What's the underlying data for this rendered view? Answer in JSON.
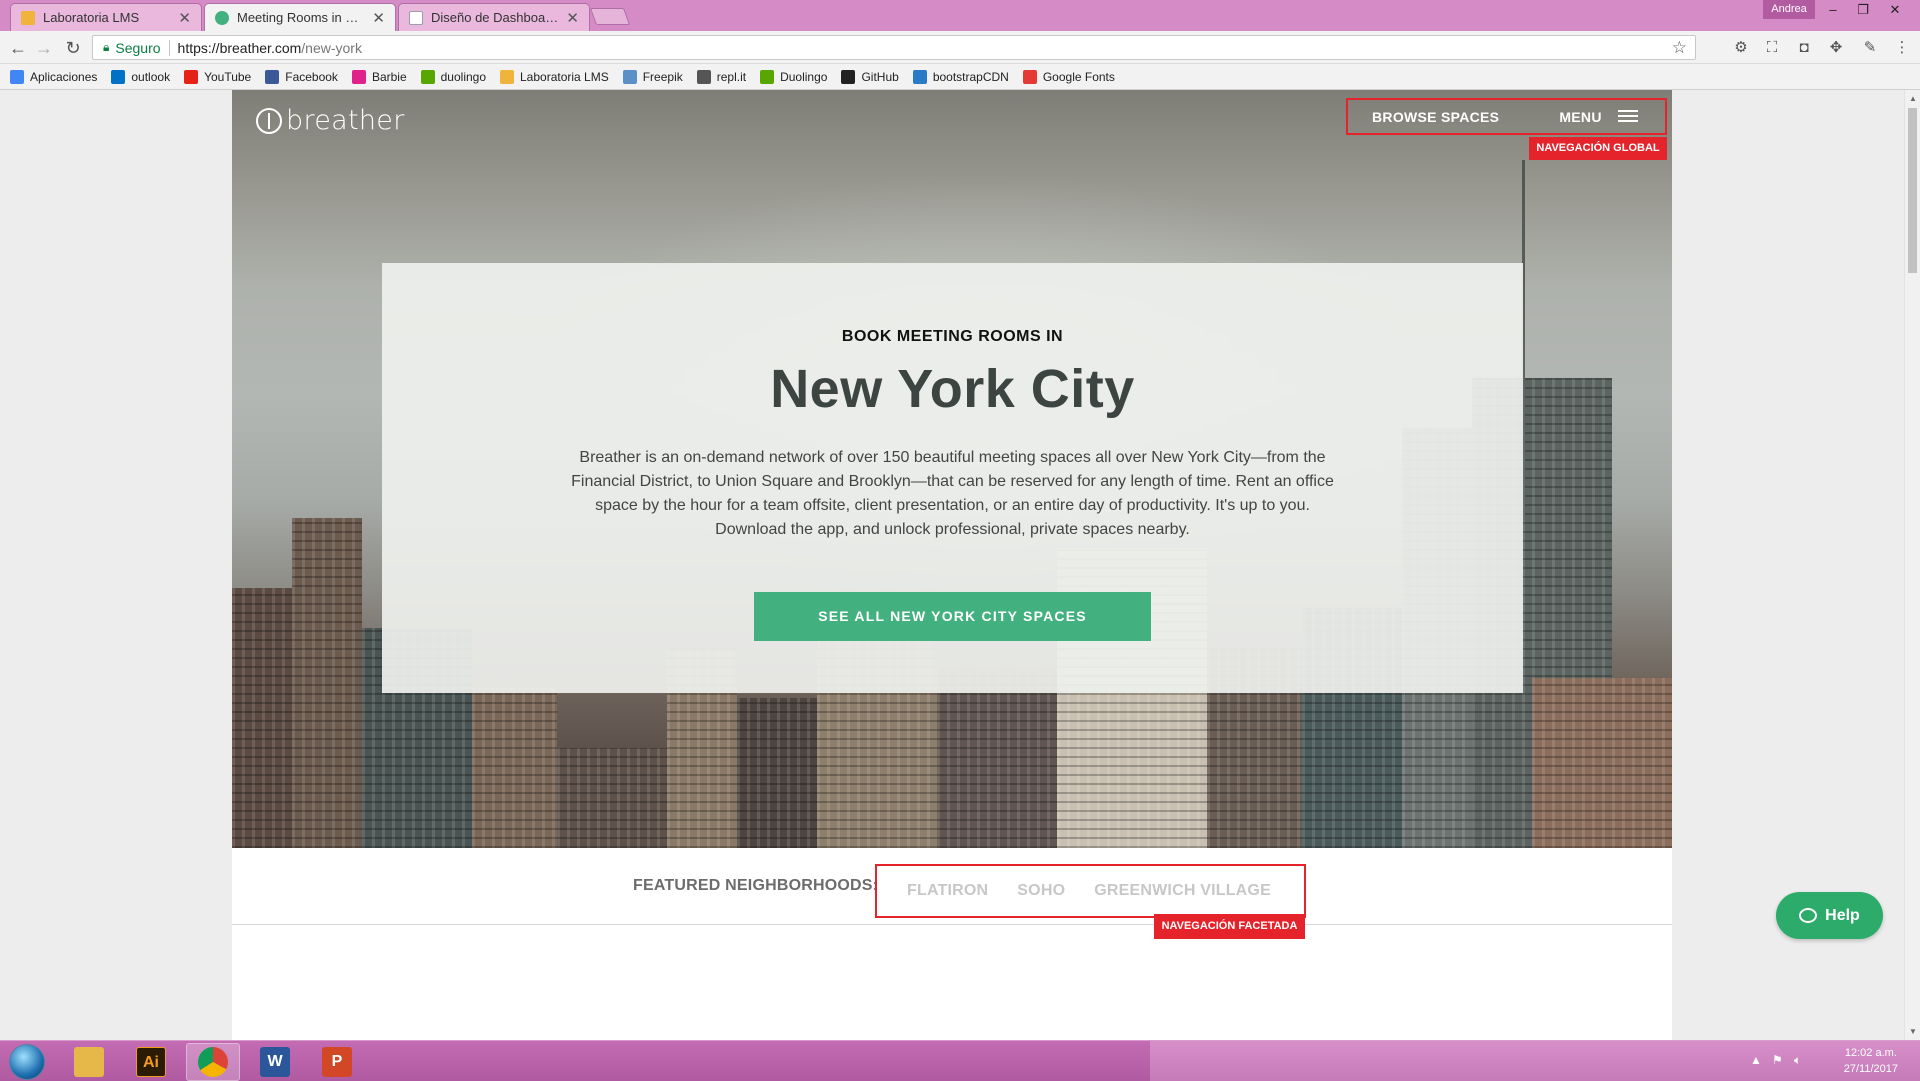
{
  "browser": {
    "tabs": [
      {
        "title": "Laboratoria LMS",
        "favicon_color": "#f0b43c"
      },
      {
        "title": "Meeting Rooms in New Y",
        "favicon_color": "#43b17f"
      },
      {
        "title": "Diseño de Dashboards E",
        "favicon_color": "#9aa0a6"
      }
    ],
    "user": "Andrea",
    "security_label": "Seguro",
    "url_host": "https://breather.com",
    "url_path": "/new-york",
    "bookmarks": [
      {
        "label": "Aplicaciones",
        "color": "#4285f4",
        "icon": "apps-grid-icon"
      },
      {
        "label": "outlook",
        "color": "#0072c6",
        "icon": "outlook-icon"
      },
      {
        "label": "YouTube",
        "color": "#e62117",
        "icon": "youtube-icon"
      },
      {
        "label": "Facebook",
        "color": "#3b5998",
        "icon": "facebook-icon"
      },
      {
        "label": "Barbie",
        "color": "#e0218a",
        "icon": "barbie-icon"
      },
      {
        "label": "duolingo",
        "color": "#58a700",
        "icon": "duolingo-icon"
      },
      {
        "label": "Laboratoria LMS",
        "color": "#f0b43c",
        "icon": "laboratoria-icon"
      },
      {
        "label": "Freepik",
        "color": "#5b8fc7",
        "icon": "freepik-icon"
      },
      {
        "label": "repl.it",
        "color": "#555555",
        "icon": "replit-icon"
      },
      {
        "label": "Duolingo",
        "color": "#58a700",
        "icon": "duolingo-icon"
      },
      {
        "label": "GitHub",
        "color": "#222222",
        "icon": "github-icon"
      },
      {
        "label": "bootstrapCDN",
        "color": "#2a7ac7",
        "icon": "bootstrapcdn-icon"
      },
      {
        "label": "Google Fonts",
        "color": "#e53935",
        "icon": "google-fonts-icon"
      }
    ]
  },
  "site": {
    "logo": "breather",
    "nav": {
      "browse": "BROWSE SPACES",
      "menu": "MENU",
      "annotation": "NAVEGACIÓN GLOBAL"
    },
    "hero": {
      "eyebrow": "BOOK MEETING ROOMS IN",
      "title": "New York City",
      "description": "Breather is an on-demand network of over 150 beautiful meeting spaces all over New York City—from the Financial District, to Union Square and Brooklyn—that can be reserved for any length of time. Rent an office space by the hour for a team offsite, client presentation, or an entire day of productivity. It's up to you. Download the app, and unlock professional, private spaces nearby.",
      "cta": "SEE ALL NEW YORK CITY SPACES"
    },
    "featured": {
      "label": "FEATURED NEIGHBORHOODS:",
      "items": [
        "FLATIRON",
        "SOHO",
        "GREENWICH VILLAGE"
      ],
      "annotation": "NAVEGACIÓN FACETADA"
    },
    "help": "Help"
  },
  "taskbar": {
    "apps": [
      {
        "name": "explorer",
        "label": "",
        "color": "#e6b84a"
      },
      {
        "name": "illustrator",
        "label": "Ai",
        "color": "#2b1b05"
      },
      {
        "name": "chrome",
        "label": "",
        "color": "#ffffff"
      },
      {
        "name": "word",
        "label": "W",
        "color": "#2b579a"
      },
      {
        "name": "powerpoint",
        "label": "P",
        "color": "#d24726"
      }
    ],
    "time": "12:02 a.m.",
    "date": "27/11/2017"
  },
  "colors": {
    "accent_green": "#43b17f",
    "annotation_red": "#e5232b",
    "help_green": "#2dab6b"
  }
}
